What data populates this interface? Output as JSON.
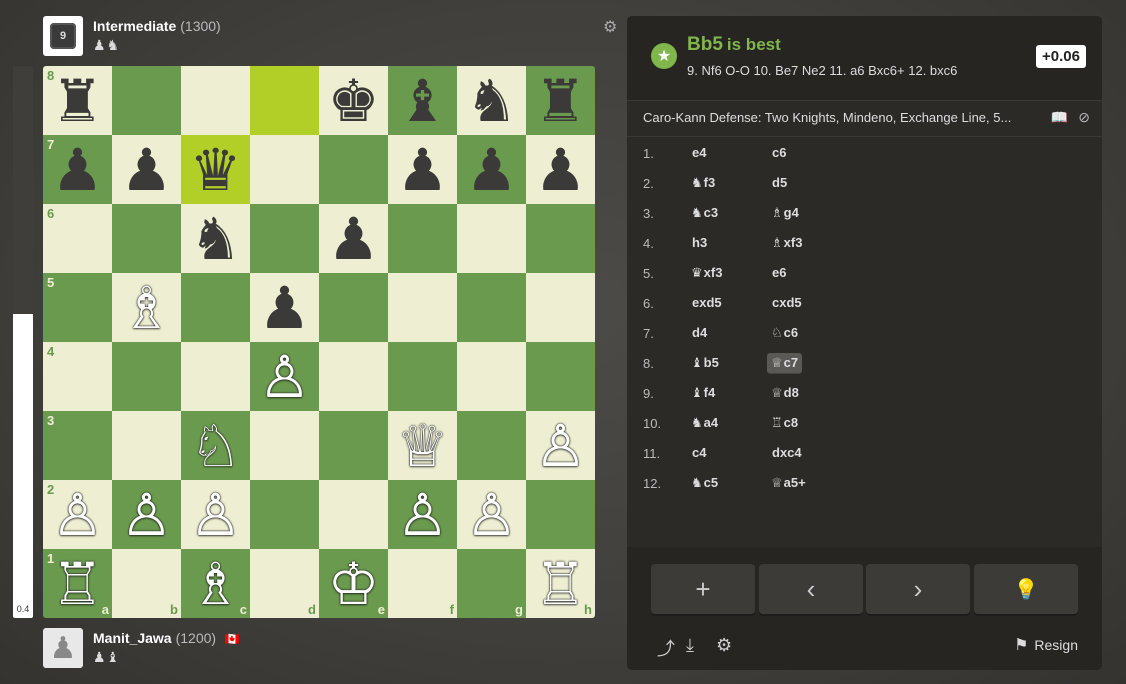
{
  "top_player": {
    "name": "Intermediate",
    "rating": "(1300)",
    "badge": "9",
    "captured": "♟♞"
  },
  "bottom_player": {
    "name": "Manit_Jawa",
    "rating": "(1200)",
    "flag": "🇨🇦",
    "captured": "♟♝"
  },
  "eval_bar": {
    "value": "0.4",
    "white_fraction": 0.55
  },
  "board": {
    "files": [
      "a",
      "b",
      "c",
      "d",
      "e",
      "f",
      "g",
      "h"
    ],
    "ranks": [
      "8",
      "7",
      "6",
      "5",
      "4",
      "3",
      "2",
      "1"
    ],
    "highlight": [
      "c7",
      "d8"
    ],
    "pieces": {
      "a8": "♜",
      "e8": "♚",
      "f8": "♝",
      "g8": "♞",
      "h8": "♜",
      "a7": "♟",
      "b7": "♟",
      "c7": "♛",
      "f7": "♟",
      "g7": "♟",
      "h7": "♟",
      "c6": "♞",
      "e6": "♟",
      "b5": "♗",
      "d5": "♟",
      "d4": "♙",
      "c3": "♘",
      "f3": "♕",
      "h3": "♙",
      "a2": "♙",
      "b2": "♙",
      "c2": "♙",
      "f2": "♙",
      "g2": "♙",
      "a1": "♖",
      "c1": "♗",
      "e1": "♔",
      "h1": "♖"
    }
  },
  "analysis": {
    "best_move": "Bb5",
    "best_suffix": "is best",
    "line": "9. Nf6 O-O 10. Be7 Ne2 11. a6 Bxc6+ 12. bxc6",
    "eval": "+0.06",
    "opening": "Caro-Kann Defense: Two Knights, Mindeno, Exchange Line, 5..."
  },
  "moves": [
    {
      "n": "1.",
      "w": {
        "f": "",
        "m": "e4"
      },
      "b": {
        "f": "",
        "m": "c6"
      }
    },
    {
      "n": "2.",
      "w": {
        "f": "♞",
        "m": "f3"
      },
      "b": {
        "f": "",
        "m": "d5"
      }
    },
    {
      "n": "3.",
      "w": {
        "f": "♞",
        "m": "c3"
      },
      "b": {
        "f": "♗",
        "m": "g4"
      }
    },
    {
      "n": "4.",
      "w": {
        "f": "",
        "m": "h3"
      },
      "b": {
        "f": "♗",
        "m": "xf3"
      }
    },
    {
      "n": "5.",
      "w": {
        "f": "♛",
        "m": "xf3"
      },
      "b": {
        "f": "",
        "m": "e6"
      }
    },
    {
      "n": "6.",
      "w": {
        "f": "",
        "m": "exd5"
      },
      "b": {
        "f": "",
        "m": "cxd5"
      }
    },
    {
      "n": "7.",
      "w": {
        "f": "",
        "m": "d4"
      },
      "b": {
        "f": "♘",
        "m": "c6"
      }
    },
    {
      "n": "8.",
      "w": {
        "f": "♝",
        "m": "b5"
      },
      "b": {
        "f": "♕",
        "m": "c7"
      }
    },
    {
      "n": "9.",
      "w": {
        "f": "♝",
        "m": "f4"
      },
      "b": {
        "f": "♕",
        "m": "d8"
      }
    },
    {
      "n": "10.",
      "w": {
        "f": "♞",
        "m": "a4"
      },
      "b": {
        "f": "♖",
        "m": "c8"
      }
    },
    {
      "n": "11.",
      "w": {
        "f": "",
        "m": "c4"
      },
      "b": {
        "f": "",
        "m": "dxc4"
      }
    },
    {
      "n": "12.",
      "w": {
        "f": "♞",
        "m": "c5"
      },
      "b": {
        "f": "♕",
        "m": "a5+"
      }
    }
  ],
  "selected_move": {
    "row": 8,
    "side": "b"
  },
  "controls": {
    "add": "+",
    "prev": "‹",
    "next": "›",
    "hint": "💡"
  },
  "footer": {
    "share": "⤴",
    "download": "⤓",
    "settings": "⚙",
    "resign_icon": "⚑",
    "resign": "Resign"
  },
  "colors": {
    "light": "#eeeed2",
    "dark": "#6a9a4e",
    "highlight": "#b2cf27",
    "accent": "#81b64c"
  }
}
